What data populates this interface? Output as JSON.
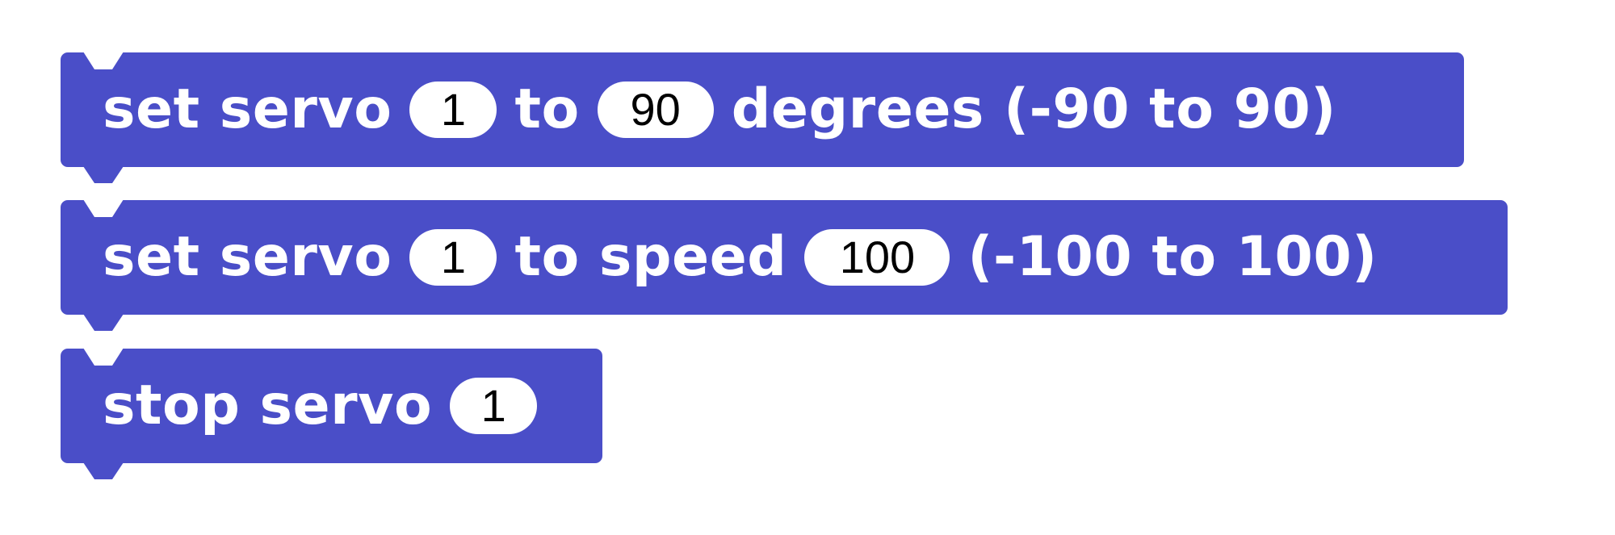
{
  "blocks": [
    {
      "parts": [
        "set servo",
        "1",
        "to",
        "90",
        "degrees (-90 to 90)"
      ]
    },
    {
      "parts": [
        "set servo",
        "1",
        "to speed",
        "100",
        "(-100 to 100)"
      ]
    },
    {
      "parts": [
        "stop servo",
        "1"
      ]
    }
  ],
  "colors": {
    "block": "#4a4ec8",
    "field": "#ffffff",
    "field_text": "#000000",
    "label_text": "#ffffff"
  }
}
